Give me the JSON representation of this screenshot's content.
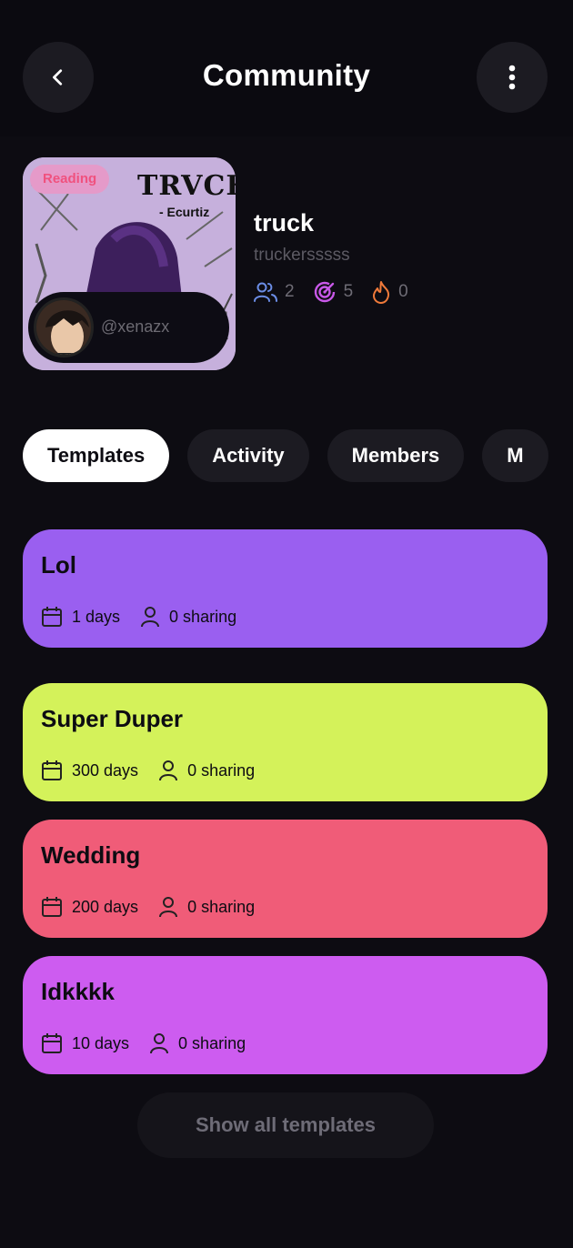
{
  "header": {
    "title": "Community"
  },
  "community": {
    "cover": {
      "badge": "Reading",
      "title": "TRVCK",
      "subtitle": "- Ecurtiz"
    },
    "owner_handle": "@xenazx",
    "name": "truck",
    "handle": "truckersssss",
    "stats": {
      "members": "2",
      "progress": "5",
      "streak": "0"
    },
    "stat_colors": {
      "members": "#6b8de6",
      "progress": "#c858e8",
      "streak": "#f07a3a"
    }
  },
  "tabs": [
    {
      "label": "Templates",
      "active": true
    },
    {
      "label": "Activity"
    },
    {
      "label": "Members"
    },
    {
      "label": "M"
    }
  ],
  "templates": [
    {
      "title": "Lol",
      "days": "1 days",
      "sharing": "0 sharing",
      "color": "#9a5ff0"
    },
    {
      "title": "Super Duper",
      "days": "300 days",
      "sharing": "0 sharing",
      "color": "#d4f25a"
    },
    {
      "title": "Wedding",
      "days": "200 days",
      "sharing": "0 sharing",
      "color": "#f05c78"
    },
    {
      "title": "Idkkkk",
      "days": "10 days",
      "sharing": "0 sharing",
      "color": "#cd5cf0"
    }
  ],
  "show_all_label": "Show all templates"
}
